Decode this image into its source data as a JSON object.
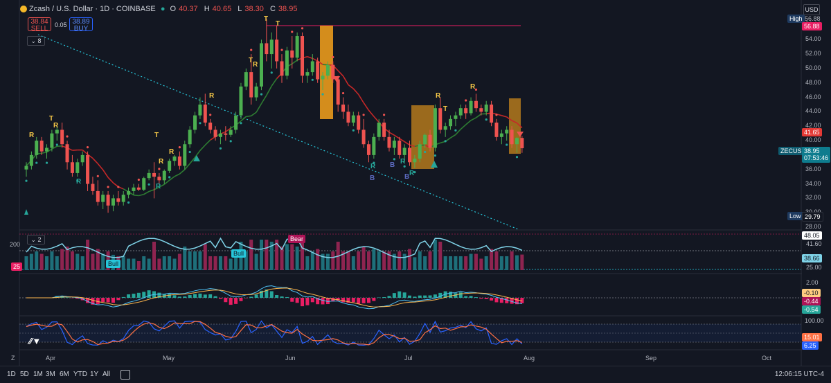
{
  "header": {
    "symbol": "Zcash / U.S. Dollar · 1D · COINBASE",
    "o_label": "O",
    "o": "40.37",
    "h_label": "H",
    "h": "40.65",
    "l_label": "L",
    "l": "38.30",
    "c_label": "C",
    "c": "38.95",
    "sell_price": "38.84",
    "sell_label": "SELL",
    "spread": "0.05",
    "buy_price": "38.89",
    "buy_label": "BUY",
    "indicator_count": "8"
  },
  "currency": "USD",
  "price_axis": {
    "ticks": [
      "56.00",
      "54.00",
      "52.00",
      "50.00",
      "48.00",
      "46.00",
      "44.00",
      "42.00",
      "40.00",
      "38.00",
      "36.00",
      "34.00",
      "32.00",
      "30.00",
      "28.00"
    ],
    "high_label": "High",
    "high_value": "56.88",
    "high_top": "56.88",
    "level_value": "41.65",
    "symbol_label": "ZECUSD",
    "last_price": "38.95",
    "countdown": "07:53:46",
    "low_label": "Low",
    "low_value": "29.79"
  },
  "osc1": {
    "count": "2",
    "left_value": "200",
    "left_badge": "25",
    "bull_label_1": "Bull",
    "bull_label_2": "Bull",
    "bear_label": "Bear",
    "ticks": [
      "48.05",
      "41.60",
      "38.66",
      "25.00"
    ]
  },
  "macd": {
    "ticks": [
      "2.00",
      "-0.10",
      "-0.44",
      "-0.54"
    ]
  },
  "stoch": {
    "ticks": [
      "100.00",
      "15.01",
      "6.25"
    ]
  },
  "markers": {
    "T": "T",
    "R": "R",
    "B": "B"
  },
  "time_axis": [
    "Apr",
    "May",
    "Jun",
    "Jul",
    "Aug",
    "Sep",
    "Oct"
  ],
  "timeframes": [
    "1D",
    "5D",
    "1M",
    "3M",
    "6M",
    "YTD",
    "1Y",
    "All"
  ],
  "clock": "12:06:15 UTC-4",
  "colors": {
    "bg": "#131722",
    "up": "#4caf50",
    "down": "#ef5350",
    "teal": "#26c6da",
    "orange": "#f7a21b",
    "red": "#e53935",
    "green": "#26a69a"
  },
  "chart_data": {
    "type": "candlestick",
    "ylim": [
      28,
      57
    ],
    "candles": [
      [
        36,
        37,
        35,
        36.5
      ],
      [
        36.5,
        38.5,
        36,
        38
      ],
      [
        38,
        40.5,
        37.5,
        40
      ],
      [
        40,
        40.5,
        38,
        38.5
      ],
      [
        38.5,
        39.5,
        37.5,
        39
      ],
      [
        39,
        41.5,
        38.5,
        41
      ],
      [
        41,
        42,
        40,
        41.5
      ],
      [
        41.5,
        42.5,
        39,
        39.5
      ],
      [
        39.5,
        40,
        36,
        37
      ],
      [
        37,
        38,
        35,
        35.5
      ],
      [
        35.5,
        37.5,
        35,
        37
      ],
      [
        37,
        38.5,
        36.5,
        38
      ],
      [
        38,
        38.5,
        33,
        34
      ],
      [
        34,
        35,
        32.5,
        33
      ],
      [
        33,
        34.5,
        31,
        31.5
      ],
      [
        31.5,
        33,
        30.5,
        32.5
      ],
      [
        32.5,
        33,
        30,
        31
      ],
      [
        31,
        32.5,
        30.2,
        32
      ],
      [
        32,
        33,
        31,
        31.5
      ],
      [
        31.5,
        33,
        31,
        32.5
      ],
      [
        32.5,
        33.5,
        32,
        33
      ],
      [
        33,
        34,
        32.5,
        33.5
      ],
      [
        33.5,
        34,
        33,
        33.2
      ],
      [
        33.2,
        35,
        33,
        34.8
      ],
      [
        34.8,
        36,
        34.5,
        35.5
      ],
      [
        35.5,
        37,
        32,
        35
      ],
      [
        35,
        35.5,
        34,
        34.5
      ],
      [
        34.5,
        36,
        34,
        35.8
      ],
      [
        35.8,
        37.5,
        35.5,
        37.2
      ],
      [
        37.2,
        38,
        36.5,
        37.8
      ],
      [
        37.8,
        38.5,
        36,
        36.5
      ],
      [
        36.5,
        40,
        36,
        39.5
      ],
      [
        39.5,
        42,
        39,
        41.5
      ],
      [
        41.5,
        44,
        41,
        43.5
      ],
      [
        43.5,
        46,
        43,
        45
      ],
      [
        45,
        46.5,
        42,
        42.5
      ],
      [
        42.5,
        43,
        41,
        41.5
      ],
      [
        41.5,
        42,
        40,
        40.5
      ],
      [
        40.5,
        41.5,
        39.5,
        41
      ],
      [
        41,
        42,
        40,
        40.8
      ],
      [
        40.8,
        42,
        40.5,
        41.5
      ],
      [
        41.5,
        44,
        41,
        43.5
      ],
      [
        43.5,
        48,
        43,
        47.5
      ],
      [
        47.5,
        50,
        47,
        49.5
      ],
      [
        49.5,
        52,
        45,
        46
      ],
      [
        46,
        48,
        45.5,
        47.5
      ],
      [
        47.5,
        54,
        47,
        53.5
      ],
      [
        53.5,
        56.88,
        51,
        52
      ],
      [
        52,
        55,
        50,
        54
      ],
      [
        54,
        56,
        50,
        51
      ],
      [
        51,
        52,
        48,
        49
      ],
      [
        49,
        53,
        48.5,
        52.5
      ],
      [
        52.5,
        54.5,
        50,
        51.5
      ],
      [
        51.5,
        55,
        51,
        54.5
      ],
      [
        54.5,
        55,
        48,
        49
      ],
      [
        49,
        50,
        48,
        49.5
      ],
      [
        49.5,
        52,
        49,
        51
      ],
      [
        51,
        51.5,
        48,
        48.5
      ],
      [
        48.5,
        49.5,
        47,
        49
      ],
      [
        49,
        51,
        48.5,
        50.5
      ],
      [
        50.5,
        51,
        48,
        48.5
      ],
      [
        48.5,
        49,
        44,
        45
      ],
      [
        45,
        46,
        43,
        44
      ],
      [
        44,
        45,
        42,
        42.5
      ],
      [
        42.5,
        44,
        42,
        43.5
      ],
      [
        43.5,
        44,
        41,
        41.5
      ],
      [
        41.5,
        43,
        39,
        39.5
      ],
      [
        39.5,
        40,
        37,
        38
      ],
      [
        38,
        41,
        37.5,
        40.5
      ],
      [
        40.5,
        43,
        40,
        42.5
      ],
      [
        42.5,
        43,
        40,
        40.5
      ],
      [
        40.5,
        41.5,
        38.5,
        39
      ],
      [
        39,
        40.5,
        38,
        40
      ],
      [
        40,
        40.5,
        37.5,
        38
      ],
      [
        38,
        39.5,
        37,
        39
      ],
      [
        39,
        40,
        36.5,
        37
      ],
      [
        37,
        38,
        36.2,
        37.5
      ],
      [
        37.5,
        40,
        37,
        39.5
      ],
      [
        39.5,
        41,
        39,
        40.8
      ],
      [
        40.8,
        41.5,
        38.5,
        39
      ],
      [
        39,
        45,
        38.5,
        44.5
      ],
      [
        44.5,
        46,
        41,
        41.5
      ],
      [
        41.5,
        42.5,
        40.5,
        42
      ],
      [
        42,
        43.5,
        41.5,
        43
      ],
      [
        43,
        44,
        42,
        43.5
      ],
      [
        43.5,
        45,
        43,
        44.5
      ],
      [
        44.5,
        45,
        43,
        43.8
      ],
      [
        43.8,
        46,
        43.5,
        45.5
      ],
      [
        45.5,
        46.5,
        44,
        44.5
      ],
      [
        44.5,
        45,
        43.5,
        44
      ],
      [
        44,
        45.5,
        43.5,
        45
      ],
      [
        45,
        45.5,
        42,
        42.5
      ],
      [
        42.5,
        43,
        40,
        40.5
      ],
      [
        40.5,
        41.5,
        39.5,
        41
      ],
      [
        41,
        42,
        40,
        41.5
      ],
      [
        41.5,
        42,
        39,
        39.5
      ],
      [
        39.5,
        40.5,
        38.3,
        40.37
      ],
      [
        40.37,
        40.65,
        38.3,
        38.95
      ]
    ]
  }
}
